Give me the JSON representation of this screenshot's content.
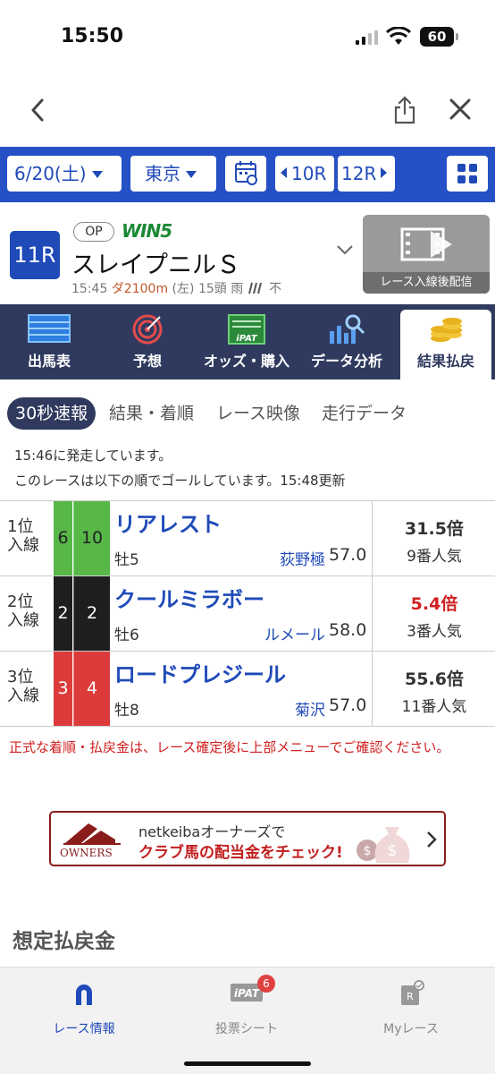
{
  "status_bar": {
    "time": "15:50",
    "battery": "60"
  },
  "date_bar": {
    "date": "6/20(土)",
    "venue": "東京",
    "prev_race": "10R",
    "next_race": "12R"
  },
  "race": {
    "number": "11R",
    "grade": "OP",
    "win5_label": "WIN5",
    "name": "スレイプニルＳ",
    "start_time": "15:45",
    "distance": "ダ2100m",
    "direction": "(左)",
    "runners": "15頭",
    "weather": "雨",
    "track": "不",
    "video_label": "レース入線後配信"
  },
  "menu": [
    {
      "label": "出馬表",
      "icon": "entry-table-icon"
    },
    {
      "label": "予想",
      "icon": "target-icon"
    },
    {
      "label": "オッズ・購入",
      "icon": "ipat-icon"
    },
    {
      "label": "データ分析",
      "icon": "chart-search-icon"
    },
    {
      "label": "結果払戻",
      "icon": "coins-icon"
    }
  ],
  "subtabs": [
    "30秒速報",
    "結果・着順",
    "レース映像",
    "走行データ"
  ],
  "messages": {
    "started": "15:46に発走しています。",
    "goal": "このレースは以下の順でゴールしています。15:48更新"
  },
  "results": [
    {
      "pos_line1": "1位",
      "pos_line2": "入線",
      "waku": "6",
      "umaban": "10",
      "name": "リアレスト",
      "sex_age": "牡5",
      "jockey": "荻野極",
      "weight": "57.0",
      "odds": "31.5倍",
      "popularity": "9番人気",
      "waku_color": "#57b848",
      "waku_text": "#222",
      "odds_color": "#333"
    },
    {
      "pos_line1": "2位",
      "pos_line2": "入線",
      "waku": "2",
      "umaban": "2",
      "name": "クールミラボー",
      "sex_age": "牡6",
      "jockey": "ルメール",
      "weight": "58.0",
      "odds": "5.4倍",
      "popularity": "3番人気",
      "waku_color": "#1e1e1e",
      "waku_text": "#fff",
      "odds_color": "#d02020"
    },
    {
      "pos_line1": "3位",
      "pos_line2": "入線",
      "waku": "3",
      "umaban": "4",
      "name": "ロードプレジール",
      "sex_age": "牡8",
      "jockey": "菊沢",
      "weight": "57.0",
      "odds": "55.6倍",
      "popularity": "11番人気",
      "waku_color": "#dd3b3b",
      "waku_text": "#fff",
      "odds_color": "#333"
    }
  ],
  "notice": "正式な着順・払戻金は、レース確定後に上部メニューでご確認ください。",
  "banner": {
    "logo_text": "OWNERS",
    "line1": "netkeibaオーナーズで",
    "line2_a": "クラブ馬の",
    "line2_b": "配当金",
    "line2_c": "をチェック!"
  },
  "section_title": "想定払戻金",
  "tabbar": [
    {
      "label": "レース情報",
      "icon": "horseshoe-icon"
    },
    {
      "label": "投票シート",
      "icon": "ipat-icon",
      "badge": "6"
    },
    {
      "label": "Myレース",
      "icon": "my-race-icon"
    }
  ]
}
